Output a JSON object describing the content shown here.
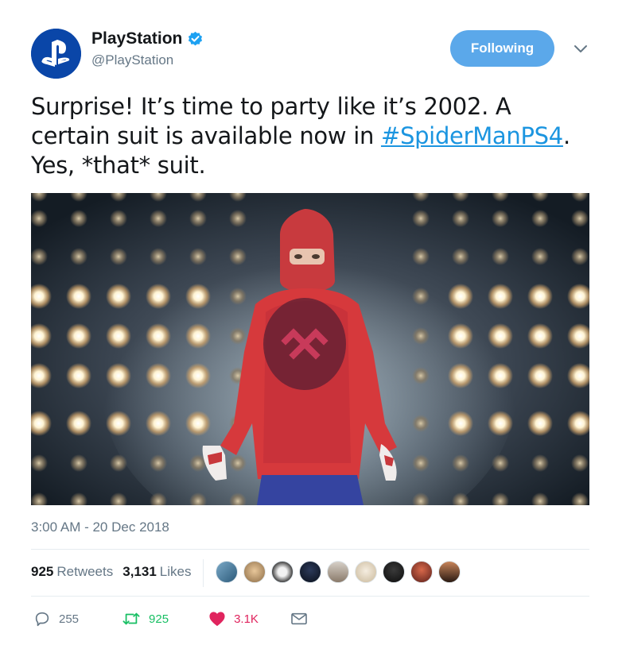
{
  "account": {
    "display_name": "PlayStation",
    "handle": "@PlayStation",
    "verified": true
  },
  "follow_button": {
    "label": "Following"
  },
  "tweet": {
    "text_before": "Surprise! It’s time to party like it’s 2002. A certain suit is available now in ",
    "hashtag": "#SpiderManPS4",
    "text_after": ". Yes, *that* suit."
  },
  "media": {
    "description_icon": "photo-spider-man-suit"
  },
  "meta": {
    "timestamp": "3:00 AM - 20 Dec 2018"
  },
  "stats": {
    "retweets_count": "925",
    "retweets_label": "Retweets",
    "likes_count": "3,131",
    "likes_label": "Likes"
  },
  "actions": {
    "reply_count": "255",
    "retweet_count": "925",
    "like_count": "3.1K"
  },
  "colors": {
    "brand_blue": "#5ba8ea",
    "link": "#1b95e0",
    "retweet_green": "#17bf63",
    "like_red": "#e0245e",
    "muted": "#657786"
  }
}
